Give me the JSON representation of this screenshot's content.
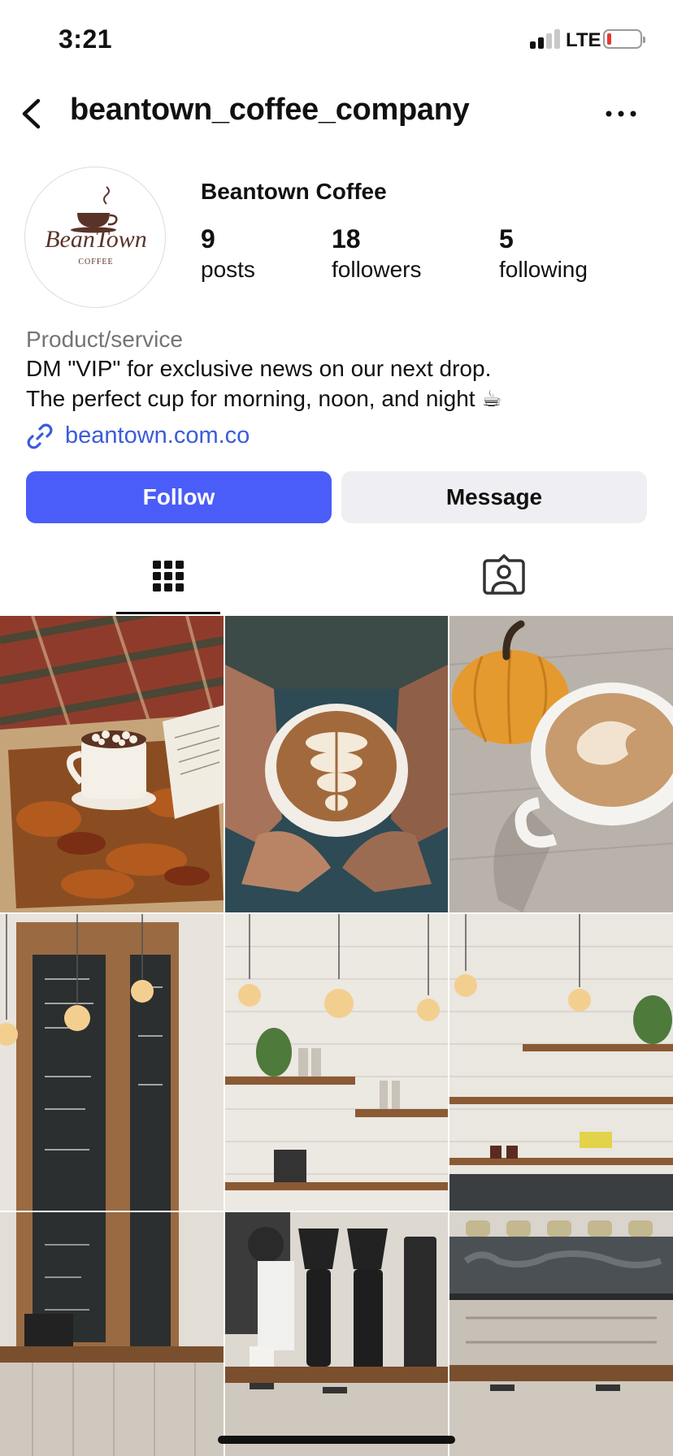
{
  "status": {
    "time": "3:21",
    "network": "LTE"
  },
  "header": {
    "username": "beantown_coffee_company"
  },
  "profile": {
    "display_name": "Beantown Coffee",
    "avatar_text": "BeanTown",
    "avatar_subtext": "COFFEE",
    "stats": [
      {
        "value": "9",
        "label": "posts"
      },
      {
        "value": "18",
        "label": "followers"
      },
      {
        "value": "5",
        "label": "following"
      }
    ],
    "category": "Product/service",
    "bio": [
      "DM \"VIP\" for exclusive news on our next drop.",
      "The perfect cup for morning, noon, and night ☕"
    ],
    "link": "beantown.com.co"
  },
  "actions": {
    "follow": "Follow",
    "message": "Message"
  },
  "tabs": [
    {
      "name": "posts-grid",
      "icon": "grid-icon",
      "active": true
    },
    {
      "name": "tagged",
      "icon": "tagged-person-icon",
      "active": false
    }
  ],
  "grid": {
    "posts": [
      "cocoa-mug-on-plaid-blanket",
      "latte-art-held-in-hands",
      "latte-with-pumpkin",
      "cafe-chalkboard-counter",
      "cafe-shelves-pendant-lights",
      "cafe-brick-wall-shelves",
      "cafe-chalkboard-counter-lower",
      "espresso-grinders-barista",
      "cafe-espresso-counter"
    ]
  },
  "colors": {
    "primary": "#4a5df9",
    "link": "#3b5bdb",
    "secondary_button": "#efeff3",
    "muted_text": "#757575",
    "battery_low": "#e53935"
  }
}
